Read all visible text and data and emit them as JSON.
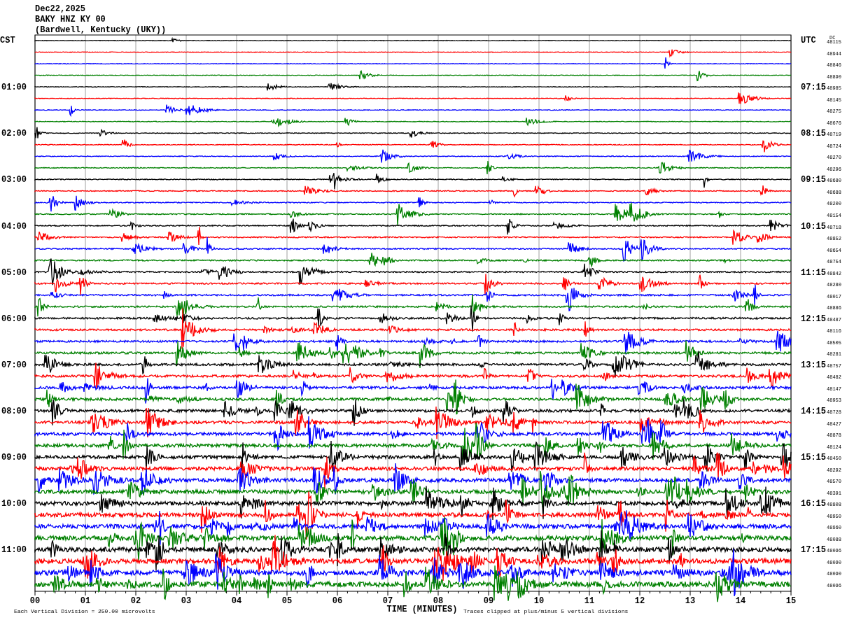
{
  "header": {
    "date": "Dec22,2025",
    "station": "BAKY HNZ KY 00",
    "location": "(Bardwell, Kentucky (UKY))"
  },
  "left_axis_title": "CST",
  "right_axis_title": "UTC",
  "dc_title": "DC",
  "rows": [
    {
      "color": "#000000",
      "dc": "48115"
    },
    {
      "color": "#ff0000",
      "dc": "48944"
    },
    {
      "color": "#0000ff",
      "dc": "48846"
    },
    {
      "color": "#008000",
      "dc": "48890"
    },
    {
      "color": "#000000",
      "dc": "48985",
      "cst": "01:00",
      "utc": "07:15"
    },
    {
      "color": "#ff0000",
      "dc": "48145"
    },
    {
      "color": "#0000ff",
      "dc": "48275"
    },
    {
      "color": "#008000",
      "dc": "48676"
    },
    {
      "color": "#000000",
      "dc": "48719",
      "cst": "02:00",
      "utc": "08:15"
    },
    {
      "color": "#ff0000",
      "dc": "48724"
    },
    {
      "color": "#0000ff",
      "dc": "48270"
    },
    {
      "color": "#008000",
      "dc": "48296"
    },
    {
      "color": "#000000",
      "dc": "48680",
      "cst": "03:00",
      "utc": "09:15"
    },
    {
      "color": "#ff0000",
      "dc": "48688"
    },
    {
      "color": "#0000ff",
      "dc": "48200"
    },
    {
      "color": "#008000",
      "dc": "48154"
    },
    {
      "color": "#000000",
      "dc": "48718",
      "cst": "04:00",
      "utc": "10:15"
    },
    {
      "color": "#ff0000",
      "dc": "48852"
    },
    {
      "color": "#0000ff",
      "dc": "48654"
    },
    {
      "color": "#008000",
      "dc": "48754"
    },
    {
      "color": "#000000",
      "dc": "48842",
      "cst": "05:00",
      "utc": "11:15"
    },
    {
      "color": "#ff0000",
      "dc": "48280"
    },
    {
      "color": "#0000ff",
      "dc": "48017"
    },
    {
      "color": "#008000",
      "dc": "48886"
    },
    {
      "color": "#000000",
      "dc": "48487",
      "cst": "06:00",
      "utc": "12:15"
    },
    {
      "color": "#ff0000",
      "dc": "48116"
    },
    {
      "color": "#0000ff",
      "dc": "48505"
    },
    {
      "color": "#008000",
      "dc": "48281"
    },
    {
      "color": "#000000",
      "dc": "48757",
      "cst": "07:00",
      "utc": "13:15"
    },
    {
      "color": "#ff0000",
      "dc": "48482"
    },
    {
      "color": "#0000ff",
      "dc": "48147"
    },
    {
      "color": "#008000",
      "dc": "48953"
    },
    {
      "color": "#000000",
      "dc": "48728",
      "cst": "08:00",
      "utc": "14:15"
    },
    {
      "color": "#ff0000",
      "dc": "48427"
    },
    {
      "color": "#0000ff",
      "dc": "48878"
    },
    {
      "color": "#008000",
      "dc": "48124"
    },
    {
      "color": "#000000",
      "dc": "48450",
      "cst": "09:00",
      "utc": "15:15"
    },
    {
      "color": "#ff0000",
      "dc": "48292"
    },
    {
      "color": "#0000ff",
      "dc": "48570"
    },
    {
      "color": "#008000",
      "dc": "48391"
    },
    {
      "color": "#000000",
      "dc": "48808",
      "cst": "10:00",
      "utc": "16:15"
    },
    {
      "color": "#ff0000",
      "dc": "48950"
    },
    {
      "color": "#0000ff",
      "dc": "48960"
    },
    {
      "color": "#008000",
      "dc": "48088"
    },
    {
      "color": "#000000",
      "dc": "48096",
      "cst": "11:00",
      "utc": "17:15"
    },
    {
      "color": "#ff0000",
      "dc": "48090"
    },
    {
      "color": "#0000ff",
      "dc": "48090"
    },
    {
      "color": "#008000",
      "dc": "48096"
    }
  ],
  "x_ticks": [
    "00",
    "01",
    "02",
    "03",
    "04",
    "05",
    "06",
    "07",
    "08",
    "09",
    "10",
    "11",
    "12",
    "13",
    "14",
    "15"
  ],
  "x_axis_title": "TIME (MINUTES)",
  "scale_note": "Each Vertical Division =  250.00 microvolts",
  "clip_note": "Traces clipped at plus/minus 5 vertical divisions"
}
